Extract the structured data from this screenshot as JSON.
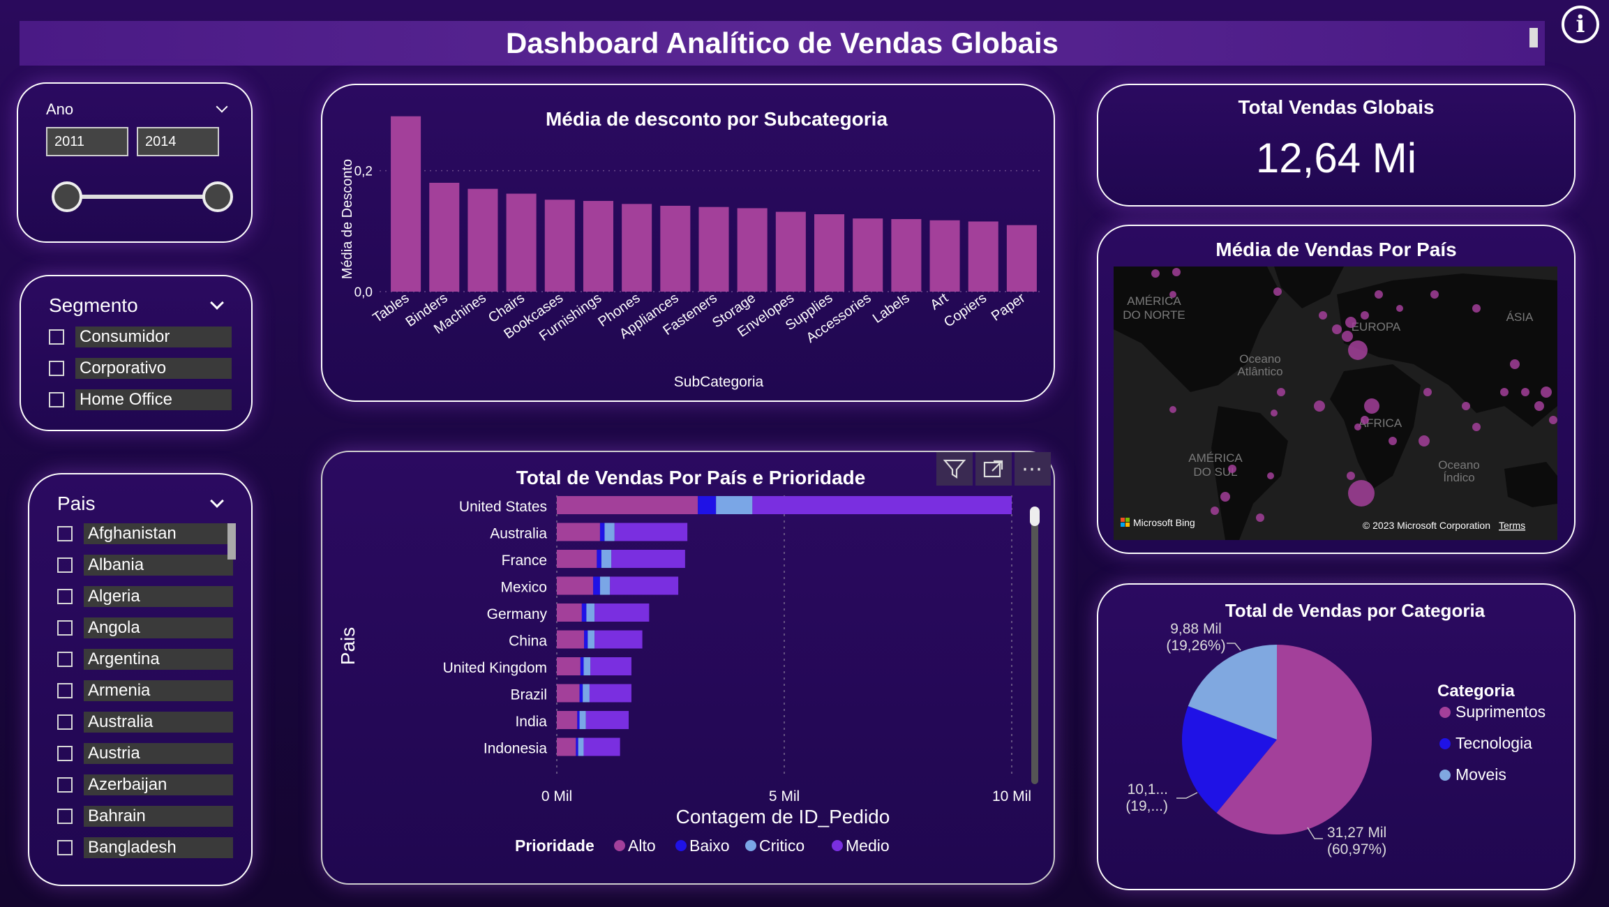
{
  "header": {
    "title": "Dashboard Analítico de Vendas Globais"
  },
  "year_slicer": {
    "label": "Ano",
    "from": "2011",
    "to": "2014"
  },
  "segment_slicer": {
    "label": "Segmento",
    "items": [
      "Consumidor",
      "Corporativo",
      "Home Office"
    ]
  },
  "country_slicer": {
    "label": "Pais",
    "items": [
      "Afghanistan",
      "Albania",
      "Algeria",
      "Angola",
      "Argentina",
      "Armenia",
      "Australia",
      "Austria",
      "Azerbaijan",
      "Bahrain",
      "Bangladesh"
    ]
  },
  "kpi": {
    "label": "Total Vendas Globais",
    "value": "12,64 Mi"
  },
  "map": {
    "title": "Média de Vendas Por País",
    "labels": {
      "na": "AMÉRICA\nDO NORTE",
      "eu": "EUROPA",
      "asia": "ÁSIA",
      "atl": "Oceano\nAtlântico",
      "africa": "ÁFRICA",
      "sa": "AMÉRICA\nDO SUL",
      "ind": "Oceano\nÍndico"
    },
    "bing": "Microsoft Bing",
    "copyright": "© 2023 Microsoft Corporation",
    "terms": "Terms"
  },
  "colors": {
    "alto": "#a3409a",
    "baixo": "#1f12e6",
    "critico": "#7aa6e6",
    "medio": "#7a2fe0",
    "suprimentos": "#a3409a",
    "tecnologia": "#1f12e6",
    "moveis": "#80a8e0"
  },
  "chart_data": [
    {
      "type": "bar",
      "title": "Média de desconto por Subcategoria",
      "xlabel": "SubCategoria",
      "ylabel": "Média de Desconto",
      "ylim": [
        0,
        0.3
      ],
      "yticks": [
        "0,0",
        "0,2"
      ],
      "categories": [
        "Tables",
        "Binders",
        "Machines",
        "Chairs",
        "Bookcases",
        "Furnishings",
        "Phones",
        "Appliances",
        "Fasteners",
        "Storage",
        "Envelopes",
        "Supplies",
        "Accessories",
        "Labels",
        "Art",
        "Copiers",
        "Paper"
      ],
      "values": [
        0.29,
        0.18,
        0.17,
        0.162,
        0.152,
        0.15,
        0.145,
        0.142,
        0.14,
        0.138,
        0.132,
        0.128,
        0.121,
        0.12,
        0.118,
        0.116,
        0.11
      ]
    },
    {
      "type": "bar",
      "orientation": "horizontal-stacked",
      "title": "Total de Vendas Por País e Prioridade",
      "xlabel": "Contagem de ID_Pedido",
      "ylabel": "Pais",
      "xlim": [
        0,
        10
      ],
      "xticks": [
        "0 Mil",
        "5 Mil",
        "10 Mil"
      ],
      "categories": [
        "United States",
        "Australia",
        "France",
        "Mexico",
        "Germany",
        "China",
        "United Kingdom",
        "Brazil",
        "India",
        "Indonesia"
      ],
      "legend_title": "Prioridade",
      "series": [
        {
          "name": "Alto",
          "values": [
            3.1,
            0.95,
            0.88,
            0.8,
            0.55,
            0.6,
            0.52,
            0.5,
            0.45,
            0.42
          ]
        },
        {
          "name": "Baixo",
          "values": [
            0.4,
            0.1,
            0.1,
            0.15,
            0.1,
            0.08,
            0.07,
            0.07,
            0.05,
            0.05
          ]
        },
        {
          "name": "Critico",
          "values": [
            0.8,
            0.22,
            0.22,
            0.22,
            0.18,
            0.15,
            0.15,
            0.15,
            0.14,
            0.12
          ]
        },
        {
          "name": "Medio",
          "values": [
            5.7,
            1.6,
            1.62,
            1.5,
            1.2,
            1.05,
            0.9,
            0.92,
            0.94,
            0.8
          ]
        }
      ]
    },
    {
      "type": "pie",
      "title": "Total de Vendas por Categoria",
      "legend_title": "Categoria",
      "categories": [
        "Suprimentos",
        "Tecnologia",
        "Moveis"
      ],
      "values": [
        60.97,
        19.77,
        19.26
      ],
      "labels": [
        [
          "31,27 Mil",
          "(60,97%)"
        ],
        [
          "10,1...",
          "(19,...)"
        ],
        [
          "9,88 Mil",
          "(19,26%)"
        ]
      ]
    }
  ]
}
